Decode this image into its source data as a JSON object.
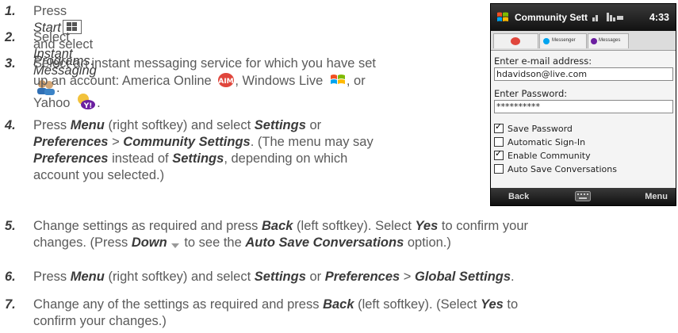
{
  "steps": [
    {
      "num": "1.",
      "parts": [
        "Press ",
        "Start",
        " and select ",
        "Programs",
        "."
      ]
    },
    {
      "num": "2.",
      "parts": [
        "Select ",
        "Instant Messaging",
        "."
      ]
    },
    {
      "num": "3.",
      "line1": "Select an instant messaging service for which you have set",
      "line2a": "up an account: America Online ",
      "line2b": ", Windows Live ",
      "line2c": ", or",
      "line3": "Yahoo ",
      "line3b": "."
    },
    {
      "num": "4.",
      "l1a": "Press ",
      "l1b": "Menu",
      "l1c": " (right softkey) and select ",
      "l1d": "Settings",
      "l1e": " or",
      "l2a": "Preferences",
      " l2b": " > ",
      "l2c": "Community Settings",
      "l2d": ". (The menu may say",
      "l3a": "Preferences",
      "l3b": " instead of ",
      "l3c": "Settings",
      "l3d": ", depending on which",
      "l4": "account you selected.)"
    },
    {
      "num": "5.",
      "l1a": "Change settings as required and press ",
      "l1b": "Back",
      "l1c": " (left softkey). Select ",
      "l1d": "Yes",
      "l1e": " to confirm your",
      "l2a": "changes. (Press ",
      "l2b": "Down",
      "l2c": " to see the ",
      "l2d": "Auto Save Conversations",
      "l2e": " option.)"
    },
    {
      "num": "6.",
      "l1a": "Press ",
      "l1b": "Menu",
      "l1c": " (right softkey) and select ",
      "l1d": "Settings",
      "l1e": " or ",
      "l1f": "Preferences",
      "l1g": " > ",
      "l1h": "Global Settings",
      "l1i": "."
    },
    {
      "num": "7.",
      "l1a": "Change any of the settings as required and press ",
      "l1b": "Back",
      "l1c": " (left softkey). (Select ",
      "l1d": "Yes",
      "l1e": " to",
      "l2": "confirm your changes.)"
    }
  ],
  "phone": {
    "title": "Community Sett",
    "time": "4:33",
    "tab2": "Messenger",
    "tab3": "Messages",
    "email_label": "Enter e-mail address:",
    "email_value": "hdavidson@live.com",
    "pw_label": "Enter Password:",
    "pw_value": "**********",
    "checks": [
      {
        "label": "Save Password",
        "checked": true
      },
      {
        "label": "Automatic Sign-In",
        "checked": false
      },
      {
        "label": "Enable Community",
        "checked": true
      },
      {
        "label": "Auto Save Conversations",
        "checked": false
      }
    ],
    "left_soft": "Back",
    "right_soft": "Menu"
  },
  "colors": {
    "aol": "#e0463c",
    "yahoo": "#6b1fa0",
    "accent": "#3a3a3a"
  }
}
